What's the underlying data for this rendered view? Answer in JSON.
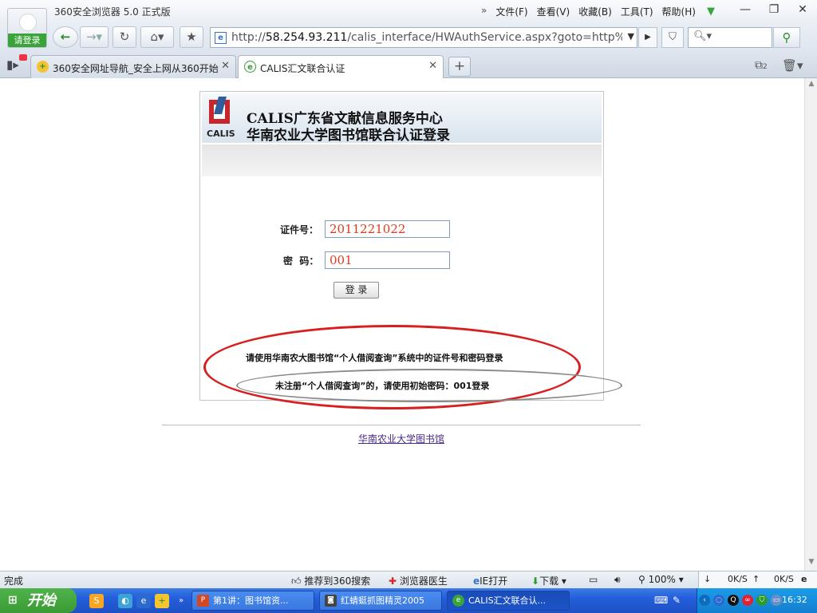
{
  "browser": {
    "title": "360安全浏览器 5.0 正式版",
    "login_label": "请登录",
    "menu": [
      {
        "label": "文件(F)"
      },
      {
        "label": "查看(V)"
      },
      {
        "label": "收藏(B)"
      },
      {
        "label": "工具(T)"
      },
      {
        "label": "帮助(H)"
      }
    ],
    "menu_chevron": "»",
    "window_buttons": {
      "minimize": "—",
      "restore": "❐",
      "close": "✕"
    }
  },
  "address_bar": {
    "url_prefix": "http://",
    "url_host": "58.254.93.211",
    "url_path": "/calis_interface/HWAuthService.aspx?goto=http%3A%",
    "search_placeholder": ""
  },
  "tabs": [
    {
      "label": "360安全网址导航_安全上网从360开始",
      "active": false
    },
    {
      "label": "CALIS汇文联合认证",
      "active": true
    }
  ],
  "tab_count": "2",
  "page": {
    "org_name": "CALIS广东省文献信息服务中心",
    "sub_name": "华南农业大学图书馆联合认证登录",
    "logo_text": "CALIS",
    "id_label": "证件号：",
    "id_value": "2011221022",
    "password_label": "密  码：",
    "password_value": "001",
    "login_button": "登 录",
    "notice_1": "请使用华南农大图书馆“个人借阅查询”系统中的证件号和密码登录",
    "notice_2": "未注册“个人借阅查询”的，请使用初始密码：001登录",
    "footer_link": "华南农业大学图书馆"
  },
  "status_bar": {
    "status_text": "完成",
    "recommend": "推荐到360搜索",
    "doctor": "浏览器医生",
    "ie_open": "IE打开",
    "download": "下载",
    "zoom": "100%",
    "down_speed": "0K/S",
    "up_speed": "0K/S"
  },
  "taskbar": {
    "start_label": "开始",
    "tasks": [
      {
        "label": "第1讲：图书馆资...",
        "active": false
      },
      {
        "label": "红蜻蜓抓图精灵2005",
        "active": false
      },
      {
        "label": "CALIS汇文联合认...",
        "active": true
      }
    ],
    "clock": "16:32"
  },
  "colors": {
    "accent_green": "#3aa33a",
    "annotation_red": "#d81e1e",
    "input_text_red": "#e03a1c",
    "taskbar_blue": "#245edb"
  }
}
